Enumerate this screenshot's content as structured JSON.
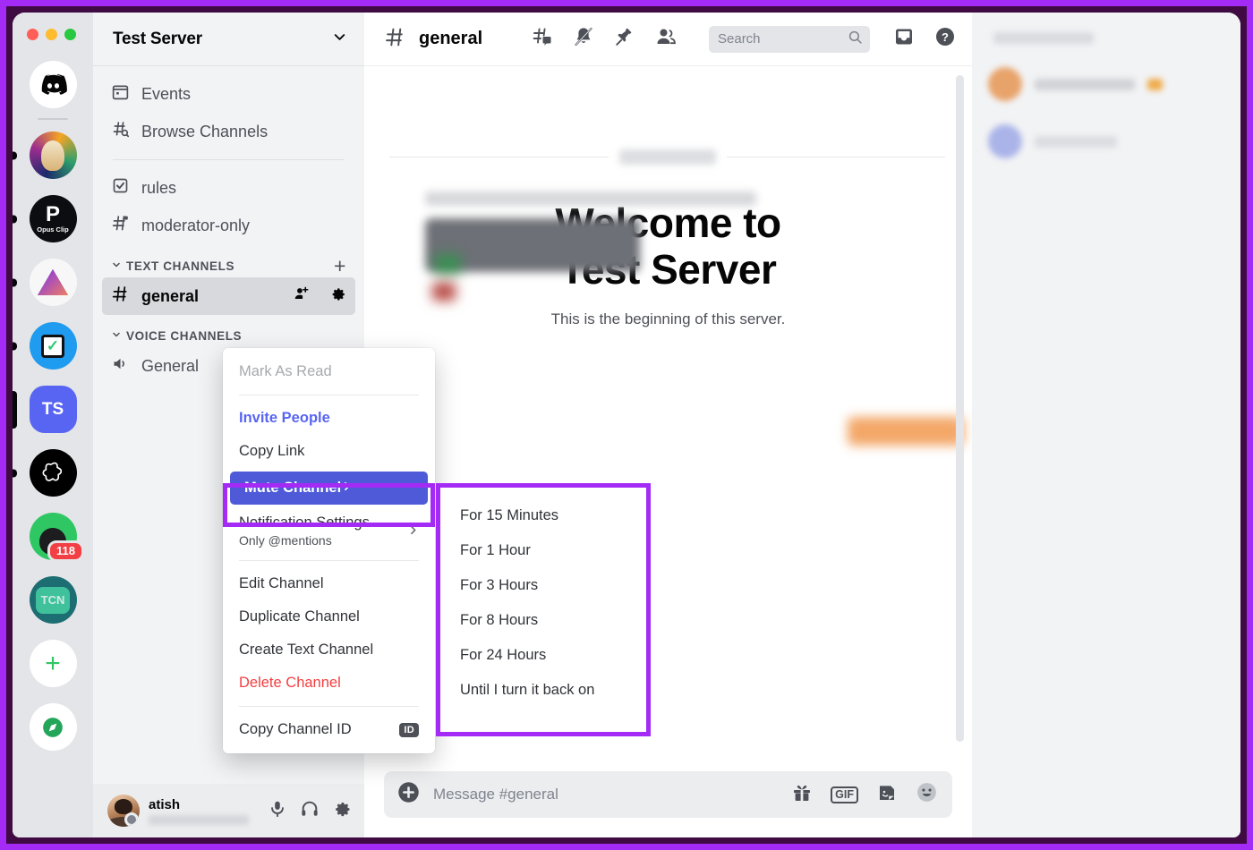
{
  "window": {
    "traffic_lights": [
      "close",
      "minimize",
      "zoom"
    ],
    "colors": {
      "annotation_purple": "#a32bf5",
      "discord_blurple": "#5865f2",
      "highlight_row": "#4e5ad7",
      "danger_red": "#f23f42",
      "outer_backdrop": "#3f0b42"
    }
  },
  "server_rail": {
    "items": [
      {
        "name": "discord-home",
        "label": "",
        "type": "home",
        "indicator": "none"
      },
      {
        "name": "server-avatar-art",
        "label": "",
        "type": "image",
        "indicator": "dot"
      },
      {
        "name": "server-opus-clip",
        "label": "Opus Clip",
        "type": "image",
        "indicator": "dot"
      },
      {
        "name": "server-verge",
        "label": "",
        "type": "image",
        "indicator": "dot"
      },
      {
        "name": "server-checkmark",
        "label": "",
        "type": "image",
        "indicator": "dot"
      },
      {
        "name": "server-test-server",
        "label": "TS",
        "type": "initials",
        "indicator": "selected"
      },
      {
        "name": "server-openai",
        "label": "",
        "type": "image",
        "indicator": "dot"
      },
      {
        "name": "server-person",
        "label": "",
        "type": "image",
        "indicator": "none",
        "badge": "118"
      },
      {
        "name": "server-tcn",
        "label": "TCN",
        "type": "image",
        "indicator": "none"
      },
      {
        "name": "add-server",
        "label": "+",
        "type": "action",
        "indicator": "none"
      },
      {
        "name": "explore-servers",
        "label": "",
        "type": "action",
        "indicator": "none"
      }
    ]
  },
  "sidebar": {
    "server_name": "Test Server",
    "top_items": [
      {
        "label": "Events",
        "icon": "calendar-icon"
      },
      {
        "label": "Browse Channels",
        "icon": "browse-channels-icon"
      }
    ],
    "pinned_channels": [
      {
        "label": "rules",
        "icon": "rules-icon"
      },
      {
        "label": "moderator-only",
        "icon": "hash-lock-icon"
      }
    ],
    "categories": [
      {
        "label": "TEXT CHANNELS",
        "add_label": "+",
        "channels": [
          {
            "label": "general",
            "icon": "hash-icon",
            "active": true,
            "actions": [
              "create-invite-icon",
              "edit-channel-icon"
            ]
          }
        ]
      },
      {
        "label": "VOICE CHANNELS",
        "channels": [
          {
            "label": "General",
            "icon": "speaker-icon",
            "active": false
          }
        ]
      }
    ]
  },
  "user_panel": {
    "username": "atish",
    "tag_redacted": true,
    "status": "idle",
    "controls": [
      "microphone-icon",
      "headphones-icon",
      "user-settings-icon"
    ]
  },
  "chat_header": {
    "channel_icon": "hash-icon",
    "channel_name": "general",
    "icons": [
      "threads-icon",
      "notification-muted-icon",
      "pinned-messages-icon",
      "member-list-icon",
      "inbox-icon",
      "help-icon"
    ]
  },
  "search": {
    "placeholder": "Search",
    "value": ""
  },
  "welcome": {
    "line1": "Welcome to",
    "line2": "Test Server",
    "subtitle": "This is the beginning of this server."
  },
  "composer": {
    "placeholder": "Message #general",
    "attach_icon": "attach-plus-icon",
    "icons": [
      "gift-icon",
      "gif-icon",
      "sticker-icon",
      "emoji-icon"
    ],
    "gif_label": "GIF"
  },
  "context_menu": {
    "items": [
      {
        "label": "Mark As Read",
        "state": "disabled",
        "name": "mark-as-read"
      },
      {
        "type": "separator"
      },
      {
        "label": "Invite People",
        "style": "invite",
        "name": "invite-people"
      },
      {
        "label": "Copy Link",
        "name": "copy-link"
      },
      {
        "label": "Mute Channel",
        "style": "highlighted",
        "submenu": true,
        "name": "mute-channel"
      },
      {
        "label": "Notification Settings",
        "sublabel": "Only @mentions",
        "submenu": true,
        "name": "notification-settings"
      },
      {
        "type": "separator"
      },
      {
        "label": "Edit Channel",
        "name": "edit-channel"
      },
      {
        "label": "Duplicate Channel",
        "name": "duplicate-channel"
      },
      {
        "label": "Create Text Channel",
        "name": "create-text-channel"
      },
      {
        "label": "Delete Channel",
        "style": "danger",
        "name": "delete-channel"
      },
      {
        "type": "separator"
      },
      {
        "label": "Copy Channel ID",
        "badge": "ID",
        "name": "copy-channel-id"
      }
    ]
  },
  "mute_submenu": {
    "items": [
      {
        "label": "For 15 Minutes"
      },
      {
        "label": "For 1 Hour"
      },
      {
        "label": "For 3 Hours"
      },
      {
        "label": "For 8 Hours"
      },
      {
        "label": "For 24 Hours"
      },
      {
        "label": "Until I turn it back on"
      }
    ]
  },
  "members_panel": {
    "redacted": true,
    "rows": 2
  }
}
